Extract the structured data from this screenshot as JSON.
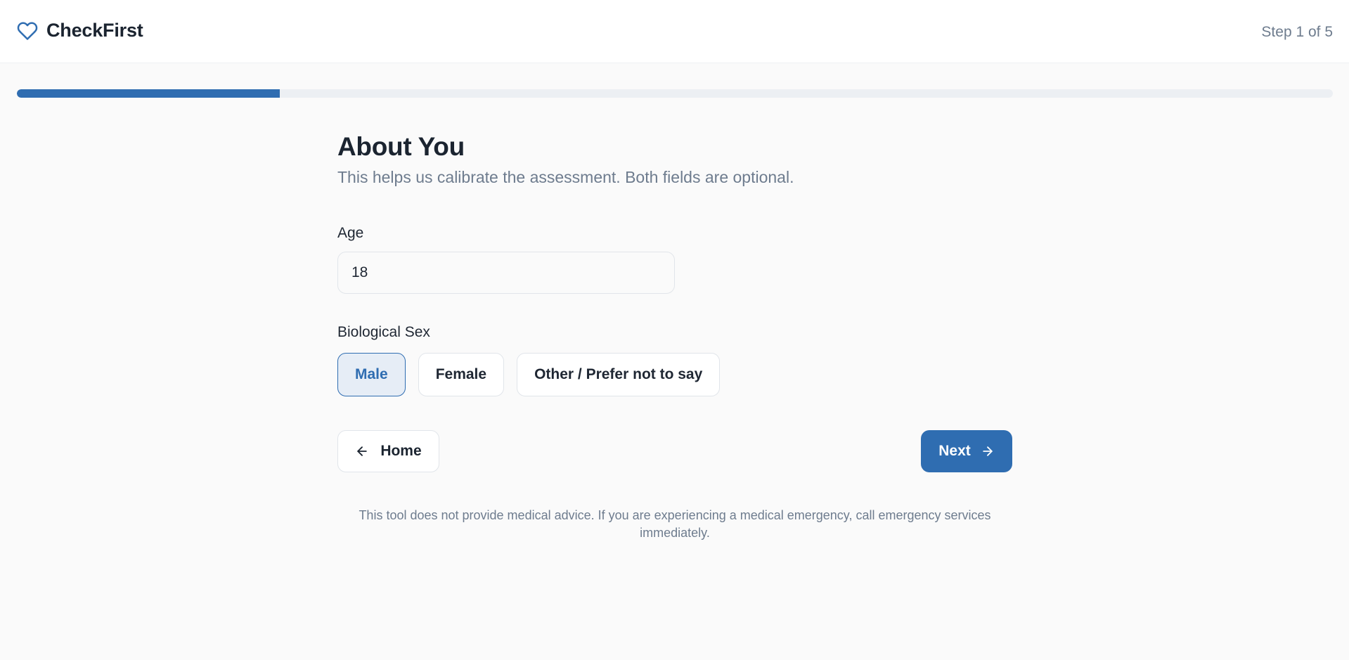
{
  "header": {
    "brand_name": "CheckFirst",
    "brand_icon": "heart-icon",
    "step_text": "Step 1 of 5"
  },
  "progress": {
    "fraction": 0.2
  },
  "form": {
    "title": "About You",
    "subtitle": "This helps us calibrate the assessment. Both fields are optional.",
    "age": {
      "label": "Age",
      "value": "18"
    },
    "sex": {
      "label": "Biological Sex",
      "options": [
        "Male",
        "Female",
        "Other / Prefer not to say"
      ],
      "selected": "Male"
    }
  },
  "nav": {
    "home_label": "Home",
    "home_icon": "arrow-left-icon",
    "next_label": "Next",
    "next_icon": "arrow-right-icon"
  },
  "disclaimer": "This tool does not provide medical advice. If you are experiencing a medical emergency, call emergency services immediately.",
  "colors": {
    "accent": "#2f6db1",
    "selected_bg": "#e6edf6",
    "muted_text": "#6e7c8e",
    "progress_track": "#eceff3"
  }
}
